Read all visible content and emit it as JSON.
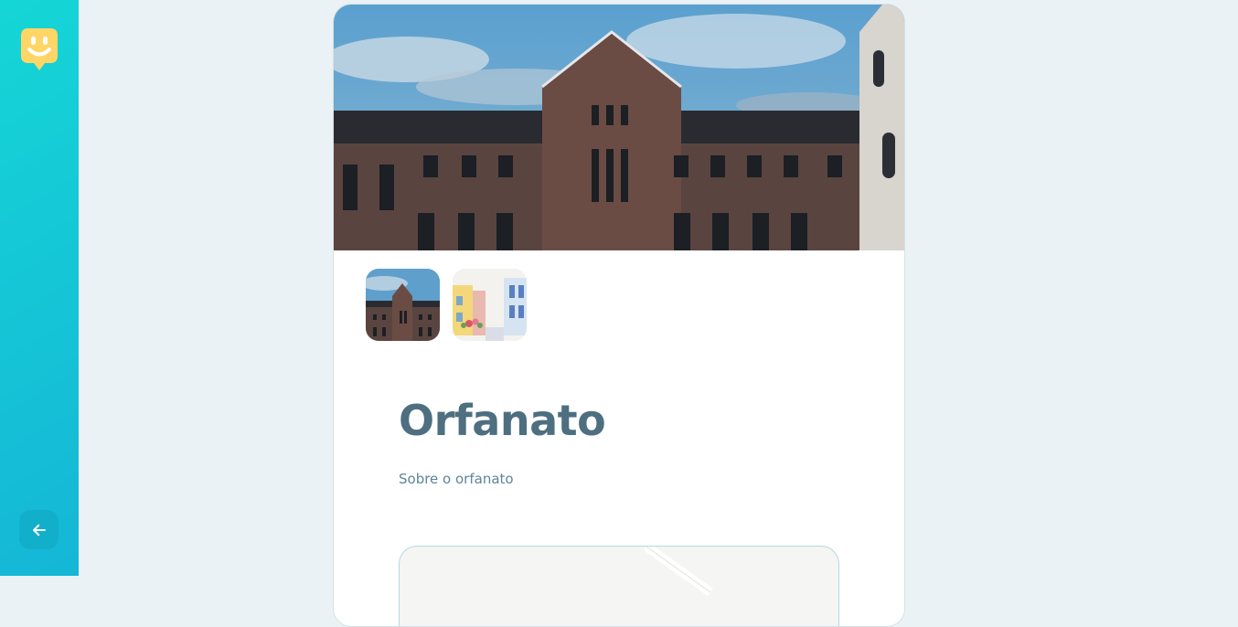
{
  "sidebar": {
    "logo_icon": "happy-face-logo-icon",
    "back_icon": "arrow-left-icon",
    "logo_color": "#ffd666",
    "gradient": [
      "#15b6d6",
      "#15d6d6"
    ]
  },
  "orphanage": {
    "name": "Orfanato",
    "about_label": "Sobre o orfanato",
    "images": [
      "building-photo",
      "colorful-street-illustration"
    ]
  },
  "colors": {
    "title": "#4d6f80",
    "text": "#5c8599",
    "background": "#ebf2f5",
    "map_border": "#b3dae2"
  }
}
